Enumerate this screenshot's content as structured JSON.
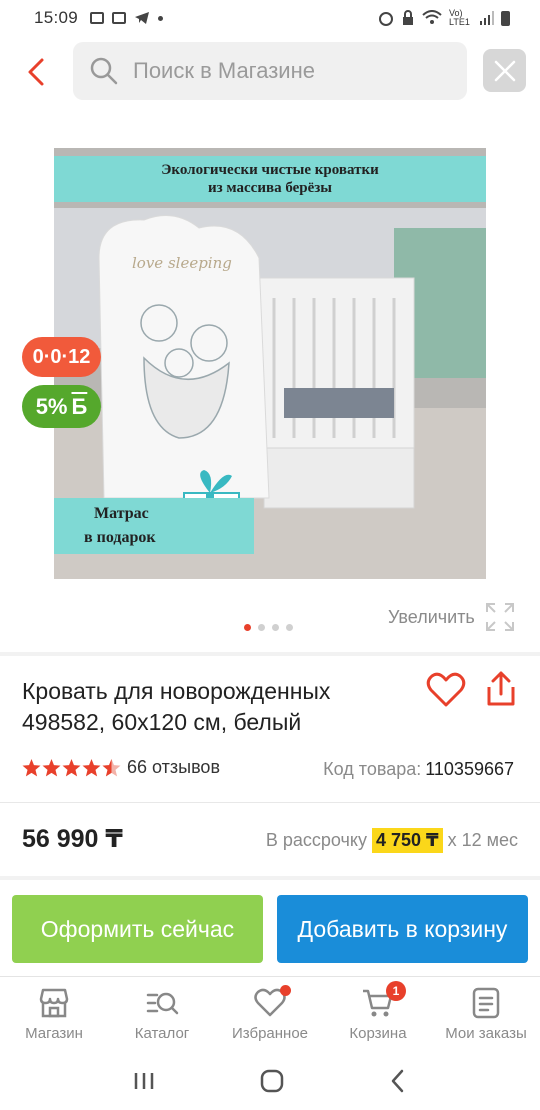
{
  "status": {
    "time": "15:09",
    "network": "Vo) LTE1"
  },
  "search": {
    "placeholder": "Поиск в Магазине"
  },
  "image": {
    "banner_top_line1": "Экологически чистые кроватки",
    "banner_top_line2": "из массива берёзы",
    "gift_line1": "Матрас",
    "gift_line2": "в подарок",
    "headboard_text": "love sleeping"
  },
  "badges": {
    "installment": "0·0·12",
    "bonus_percent": "5%",
    "bonus_currency": "Б"
  },
  "gallery": {
    "zoom_label": "Увеличить",
    "pages": 4,
    "active_page": 1
  },
  "product": {
    "title": "Кровать для новорожденных 498582, 60x120 см, белый",
    "rating": 4.5,
    "reviews": "66 отзывов",
    "code_label": "Код товара:",
    "code_value": "110359667",
    "price": "56 990 ₸",
    "installment_label": "В рассрочку",
    "installment_amount": "4 750 ₸",
    "installment_term": "х 12 мес"
  },
  "actions": {
    "buy_now": "Оформить сейчас",
    "add_to_cart": "Добавить в корзину"
  },
  "colors": {
    "accent_red": "#e8402b",
    "buy_green": "#90d050",
    "cart_blue": "#1a8dd9",
    "highlight_yellow": "#fbd71a"
  },
  "tabbar": {
    "shop": "Магазин",
    "catalog": "Каталог",
    "favorites": "Избранное",
    "cart": "Корзина",
    "orders": "Мои заказы",
    "cart_count": "1"
  }
}
